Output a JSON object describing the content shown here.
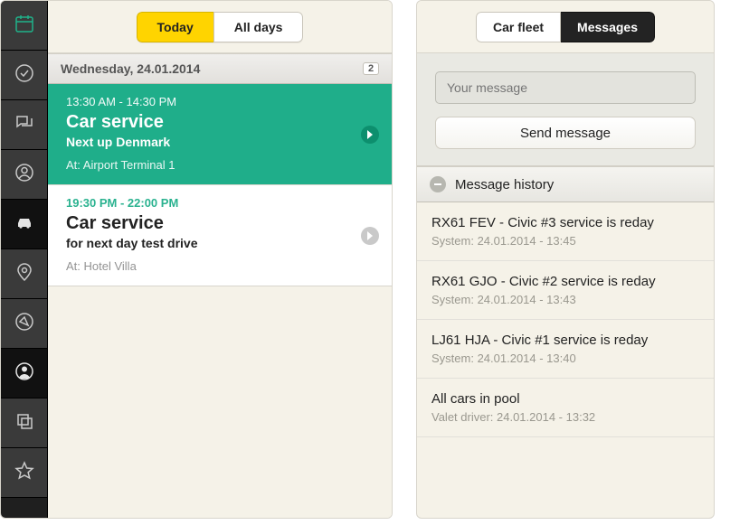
{
  "left": {
    "tabs": {
      "today": "Today",
      "alldays": "All days"
    },
    "dayHeader": {
      "label": "Wednesday, 24.01.2014",
      "count": "2"
    },
    "appts": [
      {
        "time": "13:30 AM - 14:30 PM",
        "title": "Car service",
        "sub": "Next up Denmark",
        "loc": "At: Airport Terminal 1"
      },
      {
        "time": "19:30 PM - 22:00 PM",
        "title": "Car service",
        "sub": "for next day test drive",
        "loc": "At: Hotel Villa"
      }
    ]
  },
  "right": {
    "tabs": {
      "fleet": "Car fleet",
      "messages": "Messages"
    },
    "compose": {
      "placeholder": "Your message",
      "send": "Send message"
    },
    "historyHeader": "Message history",
    "messages": [
      {
        "title": "RX61 FEV - Civic #3 service is reday",
        "meta": "System: 24.01.2014 - 13:45"
      },
      {
        "title": "RX61 GJO - Civic #2 service is reday",
        "meta": "System: 24.01.2014 - 13:43"
      },
      {
        "title": "LJ61 HJA - Civic #1 service is reday",
        "meta": "System: 24.01.2014 - 13:40"
      },
      {
        "title": "All cars in pool",
        "meta": "Valet driver: 24.01.2014 - 13:32"
      }
    ]
  }
}
